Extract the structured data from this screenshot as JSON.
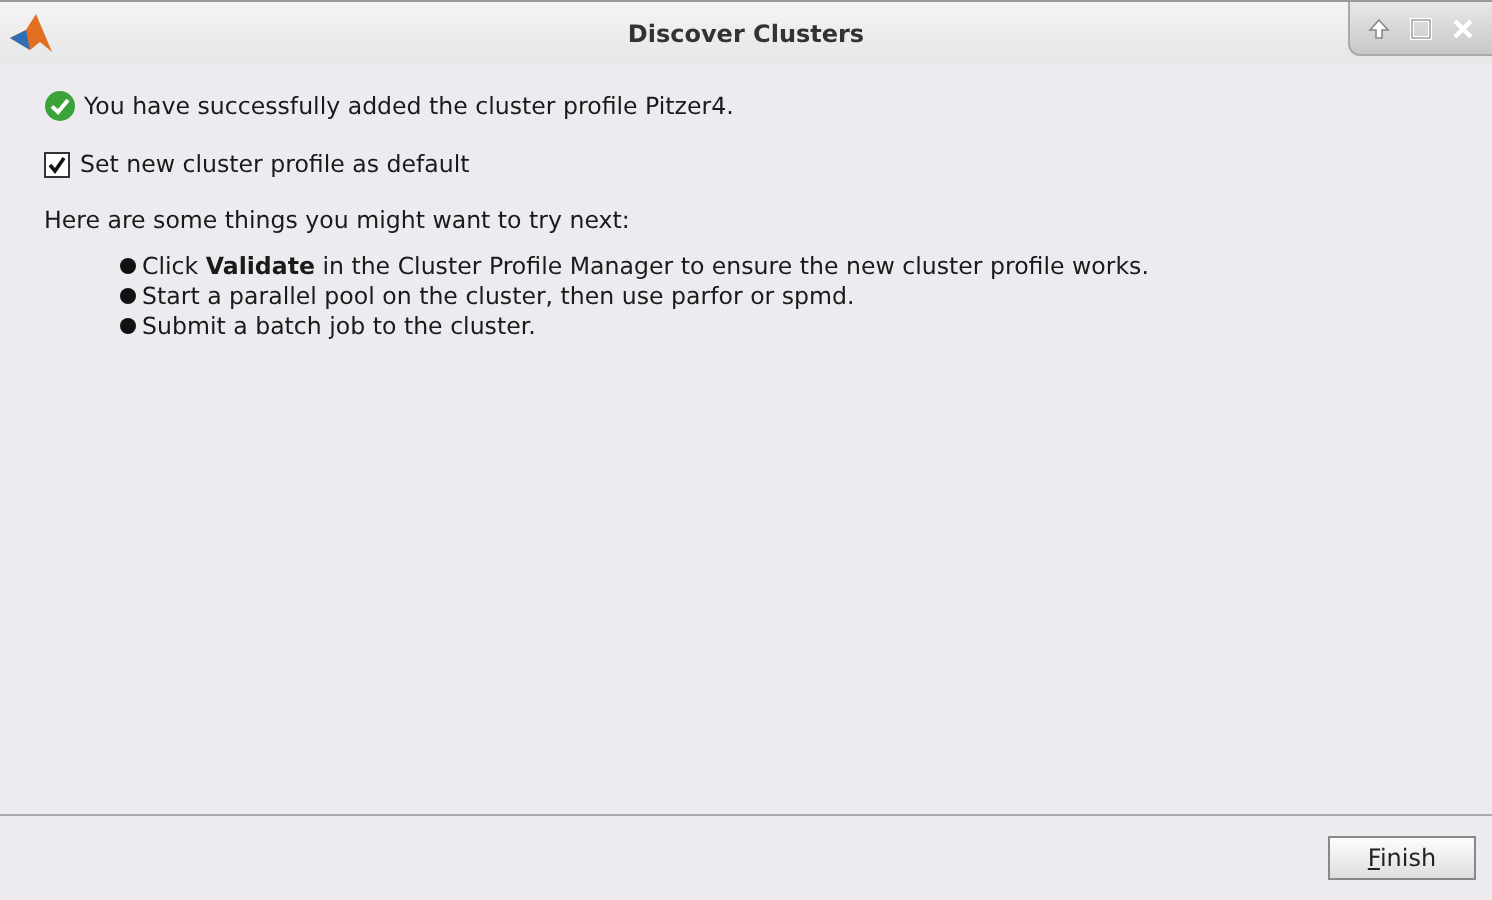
{
  "window": {
    "title": "Discover Clusters"
  },
  "success_message": "You have successfully added the cluster profile Pitzer4.",
  "default_checkbox": {
    "label": "Set new cluster profile as default",
    "checked": true
  },
  "intro": "Here are some things you might want to try next:",
  "suggestions": [
    "Click **Validate** in the Cluster Profile Manager to ensure the new cluster profile works.",
    "Start a parallel pool on the cluster, then use parfor or spmd.",
    "Submit a batch job to the cluster."
  ],
  "buttons": [
    {
      "label": "Finish",
      "mnemonic": true
    }
  ]
}
